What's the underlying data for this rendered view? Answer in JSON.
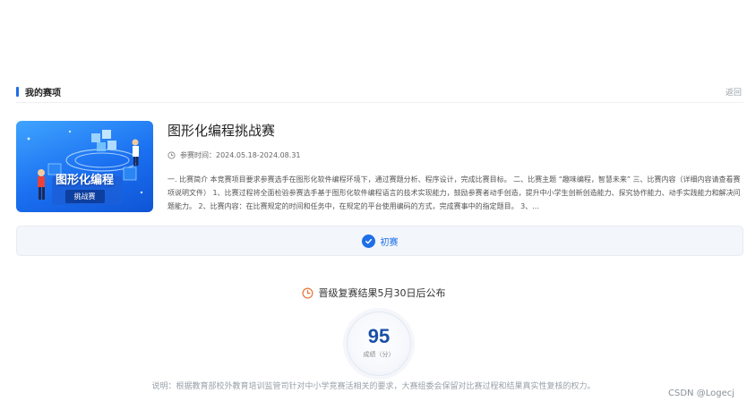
{
  "section": {
    "title": "我的赛项",
    "back_label": "返回"
  },
  "event": {
    "banner_title": "图形化编程",
    "banner_subtitle": "挑战赛",
    "title": "图形化编程挑战赛",
    "time_label": "参赛时间：2024.05.18-2024.08.31",
    "description": "一. 比赛简介 本竞赛项目要求参赛选手在图形化软件编程环境下，通过赛题分析、程序设计，完成比赛目标。 二、比赛主题 “趣味编程，智慧未来” 三、比赛内容（详细内容请查看赛项说明文件） 1、比赛过程将全面检验参赛选手基于图形化软件编程语言的技术实现能力，鼓励参赛者动手创造，提升中小学生创新创造能力、探究协作能力、动手实践能力和解决问题能力。 2、比赛内容：在比赛规定的时间和任务中，在规定的平台使用编码的方式，完成赛事中的指定题目。 3、..."
  },
  "stage": {
    "label": "初赛"
  },
  "notice": {
    "text": "晋级复赛结果5月30日后公布"
  },
  "score": {
    "value": "95",
    "unit": "成绩（分）"
  },
  "note": {
    "text": "说明：根据教育部校外教育培训监管司针对中小学竞赛活相关的要求，大赛组委会保留对比赛过程和结果真实性复核的权力。"
  },
  "watermark": "CSDN @Logecj",
  "colors": {
    "accent": "#1e6fe8",
    "notice_icon": "#e8763a"
  },
  "icons": {
    "time": "clock-icon",
    "stage": "check-circle-icon",
    "notice": "clock-icon"
  }
}
